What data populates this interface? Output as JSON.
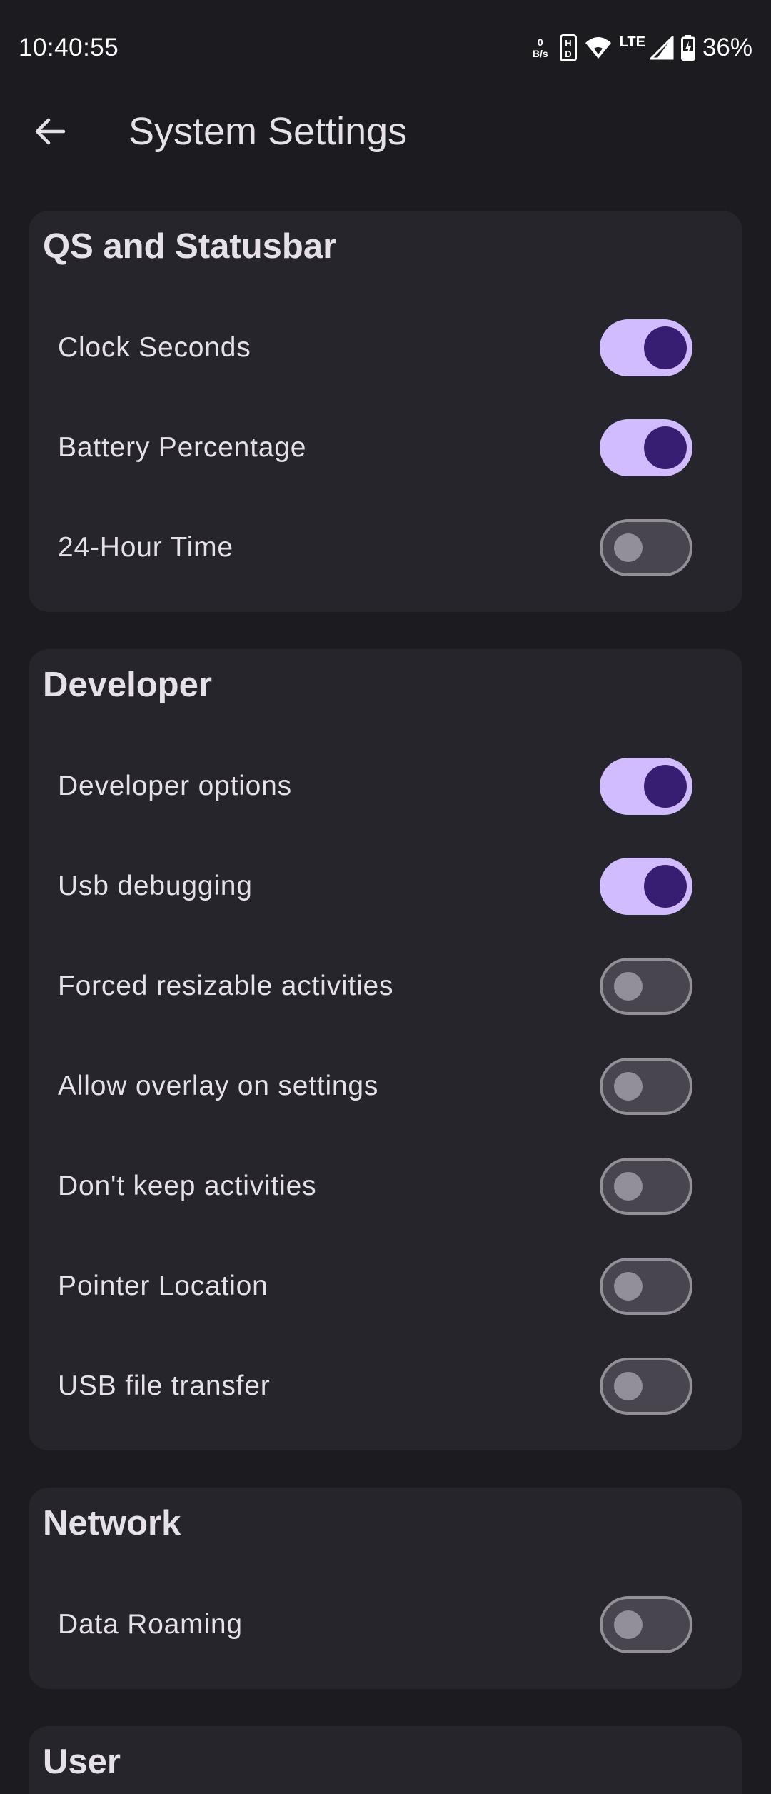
{
  "status_bar": {
    "time": "10:40:55",
    "net_speed_value": "0",
    "net_speed_unit": "B/s",
    "lte_label": "LTE",
    "battery": "36%"
  },
  "app_bar": {
    "title": "System Settings",
    "back_icon": "arrow-back-icon"
  },
  "sections": {
    "qs": {
      "title": "QS and Statusbar",
      "items": [
        {
          "label": "Clock Seconds",
          "on": true
        },
        {
          "label": "Battery Percentage",
          "on": true
        },
        {
          "label": "24-Hour Time",
          "on": false
        }
      ]
    },
    "developer": {
      "title": "Developer",
      "items": [
        {
          "label": "Developer options",
          "on": true
        },
        {
          "label": "Usb debugging",
          "on": true
        },
        {
          "label": "Forced resizable activities",
          "on": false
        },
        {
          "label": "Allow overlay on settings",
          "on": false
        },
        {
          "label": "Don't keep activities",
          "on": false
        },
        {
          "label": "Pointer Location",
          "on": false
        },
        {
          "label": "USB file transfer",
          "on": false
        }
      ]
    },
    "network": {
      "title": "Network",
      "items": [
        {
          "label": "Data Roaming",
          "on": false
        }
      ]
    },
    "user": {
      "title": "User"
    }
  },
  "colors": {
    "background": "#1c1b20",
    "card": "#27252c",
    "switch_on_track": "#d0bcff",
    "switch_on_thumb": "#381e72",
    "switch_off_track": "#49454f",
    "switch_off_outline": "#938f99"
  }
}
